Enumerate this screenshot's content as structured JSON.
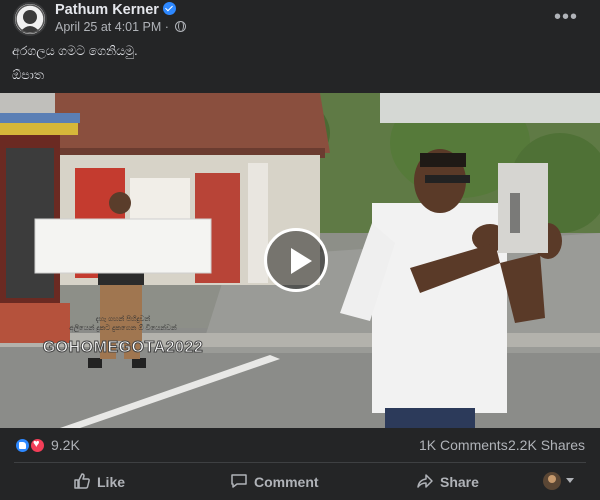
{
  "post": {
    "author": "Pathum Kerner",
    "verified": true,
    "timestamp": "April 25 at 4:01 PM",
    "audience_icon": "globe-icon",
    "more_icon": "more-options-icon",
    "text_lines": [
      "අරගලය ගමට ගෙනියමු.",
      "ඕපාත"
    ]
  },
  "video": {
    "play_icon": "play-icon",
    "sign_lines": [
      "දැහැ ගහන් පිහිදුවන්",
      "අලියෙන් දුකට දුකගෙන ඕ වියෙන්වන්"
    ],
    "sign_text": "GOHOMEGOTA2022"
  },
  "stats": {
    "reaction_icons": [
      "like-reaction-icon",
      "love-reaction-icon"
    ],
    "reactions": "9.2K",
    "comments": "1K Comments",
    "shares": "2.2K Shares"
  },
  "actions": {
    "like": "Like",
    "comment": "Comment",
    "share": "Share"
  },
  "colors": {
    "background": "#242526",
    "text": "#e4e6eb",
    "secondary_text": "#b0b3b8",
    "accent": "#2d88ff",
    "love": "#f33e58"
  }
}
